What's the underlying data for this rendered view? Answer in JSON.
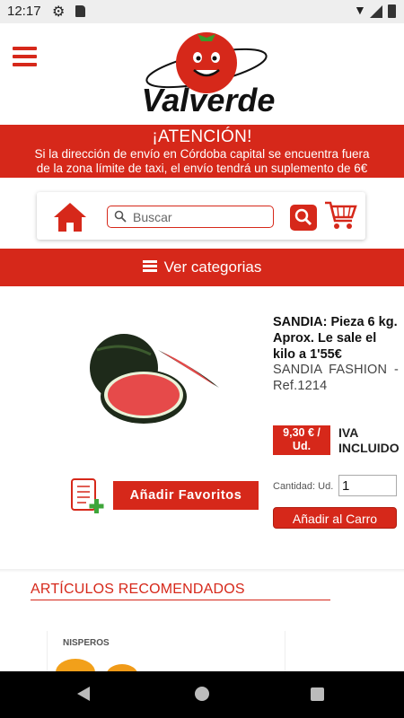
{
  "status_bar": {
    "time": "12:17"
  },
  "header": {
    "logo_text": "Valverde"
  },
  "banner": {
    "title": "¡ATENCIÓN!",
    "line1": "Si la dirección de envío en Córdoba capital se encuentra fuera",
    "line2": "de la zona límite de taxi, el envío tendrá un suplemento de 6€"
  },
  "search": {
    "placeholder": "Buscar"
  },
  "categories": {
    "label": "Ver categorias"
  },
  "product": {
    "name": "SANDIA: Pieza 6 kg. Aprox. Le sale el kilo a 1'55€",
    "subtitle": "SANDIA FASHION - Ref.1214",
    "price": "9,30 € / Ud.",
    "tax": "IVA INCLUIDO",
    "favorites_label": "Añadir Favoritos",
    "quantity_label": "Cantidad:  Ud.",
    "quantity_value": "1",
    "add_to_cart_label": "Añadir al Carro"
  },
  "recommended": {
    "title": "ARTÍCULOS RECOMENDADOS",
    "items": [
      {
        "name": "NISPEROS"
      }
    ]
  },
  "colors": {
    "brand_red": "#d6281a"
  }
}
